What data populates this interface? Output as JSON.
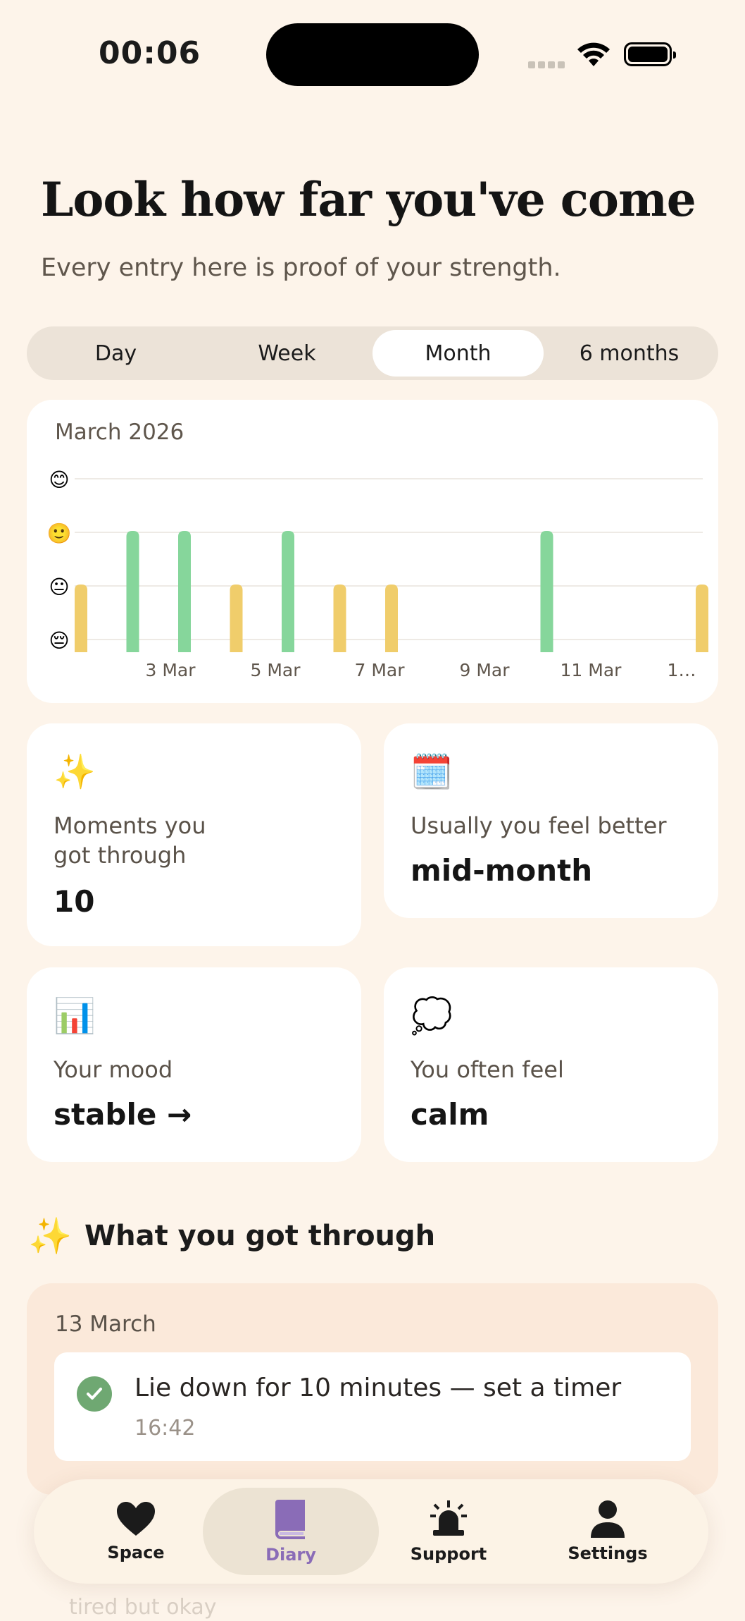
{
  "status_bar": {
    "time": "00:06"
  },
  "header": {
    "title": "Look how far you've come",
    "subtitle": "Every entry here is proof of your strength."
  },
  "period_tabs": [
    {
      "label": "Day",
      "active": false
    },
    {
      "label": "Week",
      "active": false
    },
    {
      "label": "Month",
      "active": true
    },
    {
      "label": "6 months",
      "active": false
    }
  ],
  "chart": {
    "month_label": "March 2026"
  },
  "chart_data": {
    "type": "bar",
    "title": "March 2026",
    "y_levels": [
      "😔",
      "😐",
      "🙂",
      "😊"
    ],
    "ylim": [
      1,
      4
    ],
    "x_tick_labels": [
      "3 Mar",
      "5 Mar",
      "7 Mar",
      "9 Mar",
      "11 Mar",
      "1…"
    ],
    "bars": [
      {
        "day": 1,
        "mood": 2,
        "color": "#f0cd6b"
      },
      {
        "day": 2,
        "mood": 3,
        "color": "#86d69b"
      },
      {
        "day": 3,
        "mood": 3,
        "color": "#86d69b"
      },
      {
        "day": 4,
        "mood": 2,
        "color": "#f0cd6b"
      },
      {
        "day": 5,
        "mood": 3,
        "color": "#86d69b"
      },
      {
        "day": 6,
        "mood": 2,
        "color": "#f0cd6b"
      },
      {
        "day": 7,
        "mood": 2,
        "color": "#f0cd6b"
      },
      {
        "day": 10,
        "mood": 3,
        "color": "#86d69b"
      },
      {
        "day": 13,
        "mood": 2,
        "color": "#f0cd6b"
      }
    ],
    "grid": true
  },
  "stats": [
    {
      "emoji": "✨",
      "label": "Moments you got through",
      "value": "10"
    },
    {
      "emoji": "🗓️",
      "label": "Usually you feel better",
      "value": "mid-month"
    },
    {
      "emoji": "📊",
      "label": "Your mood",
      "value": "stable →"
    },
    {
      "emoji": "💭",
      "label": "You often feel",
      "value": "calm"
    }
  ],
  "section": {
    "icon": "✨",
    "title": "What you got through"
  },
  "entries": [
    {
      "date": "13 March",
      "text": "Lie down for 10 minutes — set a timer",
      "time": "16:42"
    }
  ],
  "ghost_text": "tired but okay",
  "tabbar": [
    {
      "label": "Space",
      "icon": "heart-icon",
      "active": false
    },
    {
      "label": "Diary",
      "icon": "book-icon",
      "active": true
    },
    {
      "label": "Support",
      "icon": "alarm-icon",
      "active": false
    },
    {
      "label": "Settings",
      "icon": "person-icon",
      "active": false
    }
  ],
  "colors": {
    "background": "#fdf4ea",
    "positive": "#86d69b",
    "neutral": "#f0cd6b",
    "accent": "#8a6cb7"
  }
}
